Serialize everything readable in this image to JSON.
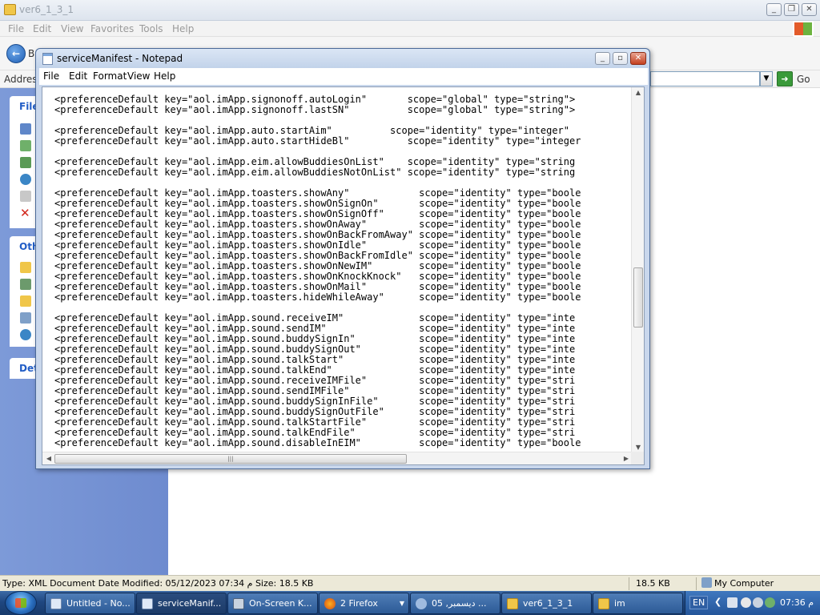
{
  "explorer": {
    "title": "ver6_1_3_1",
    "menu": [
      "File",
      "Edit",
      "View",
      "Favorites",
      "Tools",
      "Help"
    ],
    "back_label": "Ba",
    "address_label": "Address",
    "go_label": "Go",
    "side_panels": [
      "File",
      "Oth",
      "Det"
    ],
    "status": {
      "info": "Type: XML Document Date Modified: 05/12/2023 07:34 م Size: 18.5 KB",
      "size": "18.5 KB",
      "zone": "My Computer"
    }
  },
  "notepad": {
    "title": "serviceManifest - Notepad",
    "menu": [
      "File",
      "Edit",
      "Format",
      "View",
      "Help"
    ],
    "lines": [
      "<preferenceDefault key=\"aol.imApp.signonoff.autoLogin\"       scope=\"global\" type=\"string\">",
      "<preferenceDefault key=\"aol.imApp.signonoff.lastSN\"          scope=\"global\" type=\"string\">",
      "",
      "<preferenceDefault key=\"aol.imApp.auto.startAim\"          scope=\"identity\" type=\"integer\"",
      "<preferenceDefault key=\"aol.imApp.auto.startHideBl\"          scope=\"identity\" type=\"integer",
      "",
      "<preferenceDefault key=\"aol.imApp.eim.allowBuddiesOnList\"    scope=\"identity\" type=\"string",
      "<preferenceDefault key=\"aol.imApp.eim.allowBuddiesNotOnList\" scope=\"identity\" type=\"string",
      "",
      "<preferenceDefault key=\"aol.imApp.toasters.showAny\"            scope=\"identity\" type=\"boole",
      "<preferenceDefault key=\"aol.imApp.toasters.showOnSignOn\"       scope=\"identity\" type=\"boole",
      "<preferenceDefault key=\"aol.imApp.toasters.showOnSignOff\"      scope=\"identity\" type=\"boole",
      "<preferenceDefault key=\"aol.imApp.toasters.showOnAway\"         scope=\"identity\" type=\"boole",
      "<preferenceDefault key=\"aol.imApp.toasters.showOnBackFromAway\" scope=\"identity\" type=\"boole",
      "<preferenceDefault key=\"aol.imApp.toasters.showOnIdle\"         scope=\"identity\" type=\"boole",
      "<preferenceDefault key=\"aol.imApp.toasters.showOnBackFromIdle\" scope=\"identity\" type=\"boole",
      "<preferenceDefault key=\"aol.imApp.toasters.showOnNewIM\"        scope=\"identity\" type=\"boole",
      "<preferenceDefault key=\"aol.imApp.toasters.showOnKnockKnock\"   scope=\"identity\" type=\"boole",
      "<preferenceDefault key=\"aol.imApp.toasters.showOnMail\"         scope=\"identity\" type=\"boole",
      "<preferenceDefault key=\"aol.imApp.toasters.hideWhileAway\"      scope=\"identity\" type=\"boole",
      "",
      "<preferenceDefault key=\"aol.imApp.sound.receiveIM\"             scope=\"identity\" type=\"inte",
      "<preferenceDefault key=\"aol.imApp.sound.sendIM\"                scope=\"identity\" type=\"inte",
      "<preferenceDefault key=\"aol.imApp.sound.buddySignIn\"           scope=\"identity\" type=\"inte",
      "<preferenceDefault key=\"aol.imApp.sound.buddySignOut\"          scope=\"identity\" type=\"inte",
      "<preferenceDefault key=\"aol.imApp.sound.talkStart\"             scope=\"identity\" type=\"inte",
      "<preferenceDefault key=\"aol.imApp.sound.talkEnd\"               scope=\"identity\" type=\"inte",
      "<preferenceDefault key=\"aol.imApp.sound.receiveIMFile\"         scope=\"identity\" type=\"stri",
      "<preferenceDefault key=\"aol.imApp.sound.sendIMFile\"            scope=\"identity\" type=\"stri",
      "<preferenceDefault key=\"aol.imApp.sound.buddySignInFile\"       scope=\"identity\" type=\"stri",
      "<preferenceDefault key=\"aol.imApp.sound.buddySignOutFile\"      scope=\"identity\" type=\"stri",
      "<preferenceDefault key=\"aol.imApp.sound.talkStartFile\"         scope=\"identity\" type=\"stri",
      "<preferenceDefault key=\"aol.imApp.sound.talkEndFile\"           scope=\"identity\" type=\"stri",
      "<preferenceDefault key=\"aol.imApp.sound.disableInEIM\"          scope=\"identity\" type=\"boole"
    ]
  },
  "taskbar": {
    "items": [
      {
        "label": "Untitled - No...",
        "icon": "notepad-icon"
      },
      {
        "label": "serviceManif...",
        "icon": "notepad-icon"
      },
      {
        "label": "On-Screen K...",
        "icon": "keyboard-icon"
      },
      {
        "label": "2 Firefox",
        "icon": "firefox-icon"
      },
      {
        "label": "05 ,ديسمبر ...",
        "icon": "chat-icon"
      },
      {
        "label": "ver6_1_3_1",
        "icon": "folder-icon"
      },
      {
        "label": "im",
        "icon": "folder-icon"
      }
    ],
    "tray": {
      "language": "EN",
      "time": "07:36 م"
    }
  },
  "colors": {
    "taskbar": "#1f4780",
    "explorer_sidebar": "#7d9ad8",
    "notepad_frame": "#c9d7ec",
    "close_button": "#c4401f"
  }
}
